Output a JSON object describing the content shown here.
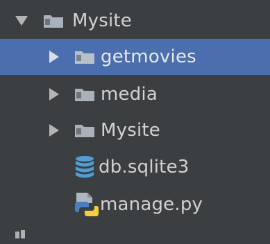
{
  "tree": {
    "root": {
      "label": "Mysite",
      "expanded": true,
      "icon": "folder-icon"
    },
    "children": [
      {
        "label": "getmovies",
        "type": "folder",
        "expanded": false,
        "selected": true,
        "icon": "folder-icon"
      },
      {
        "label": "media",
        "type": "folder",
        "expanded": false,
        "selected": false,
        "icon": "folder-icon"
      },
      {
        "label": "Mysite",
        "type": "folder",
        "expanded": false,
        "selected": false,
        "icon": "folder-icon"
      },
      {
        "label": "db.sqlite3",
        "type": "file",
        "selected": false,
        "icon": "database-icon"
      },
      {
        "label": "manage.py",
        "type": "file",
        "selected": false,
        "icon": "python-file-icon"
      }
    ]
  },
  "colors": {
    "background": "#3c3f41",
    "selection": "#4b6eaf",
    "text": "#d2d2d2",
    "folder": "#a9b2bb",
    "database": "#4f9fd6",
    "python_blue": "#4a7ec0",
    "python_yellow": "#f5cf3c"
  }
}
